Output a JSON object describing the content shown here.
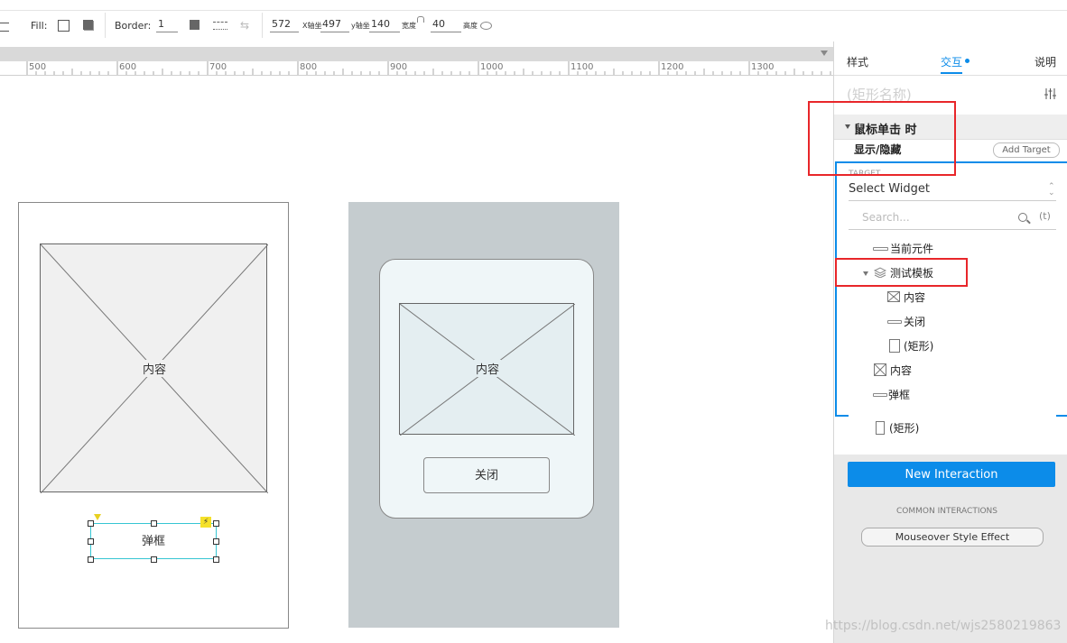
{
  "toolbar": {
    "fill_label": "Fill:",
    "border_label": "Border:",
    "border_value": "1",
    "x_value": "572",
    "x_suffix": "X轴坐",
    "y_value": "497",
    "y_suffix": "y轴坐",
    "w_value": "140",
    "w_suffix": "宽度",
    "h_value": "40",
    "h_suffix": "高度"
  },
  "ruler": {
    "ticks": [
      "500",
      "600",
      "700",
      "800",
      "900",
      "1000",
      "1100",
      "1200",
      "1300"
    ]
  },
  "canvas": {
    "left_card": {
      "placeholder_label": "内容",
      "popup_label": "弹框"
    },
    "right_card": {
      "placeholder_label": "内容",
      "close_label": "关闭"
    }
  },
  "panel": {
    "tabs": {
      "style": "样式",
      "interaction": "交互",
      "notes": "说明"
    },
    "name_placeholder": "(矩形名称)",
    "event_title": "鼠标单击 时",
    "action_title": "显示/隐藏",
    "add_target_label": "Add Target",
    "target_heading": "TARGET",
    "select_widget": "Select Widget",
    "search_placeholder": "Search...",
    "search_shortcut": "(t)",
    "tree": [
      {
        "label": "当前元件"
      },
      {
        "label": "测试模板"
      },
      {
        "label": "内容"
      },
      {
        "label": "关闭"
      },
      {
        "label": "(矩形)"
      },
      {
        "label": "内容"
      },
      {
        "label": "弹框"
      },
      {
        "label": "(矩形)"
      }
    ],
    "new_interaction_label": "New Interaction",
    "common_heading": "COMMON INTERACTIONS",
    "mouseover_label": "Mouseover Style Effect"
  },
  "watermark": "https://blog.csdn.net/wjs2580219863",
  "colors": {
    "accent": "#0c8ce9",
    "highlight": "#e8262a",
    "selection": "#36c6d3"
  }
}
